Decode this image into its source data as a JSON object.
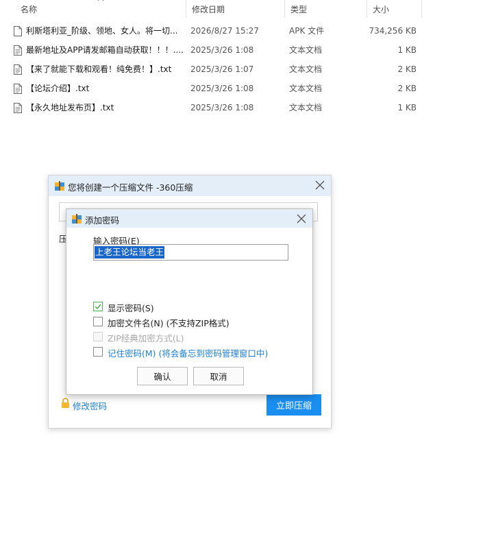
{
  "columns": {
    "name": "名称",
    "date": "修改日期",
    "type": "类型",
    "size": "大小"
  },
  "files": [
    {
      "name": "利斯塔利亚_阶级、领地、女人。将一切...",
      "date": "2026/8/27 15:27",
      "type": "APK 文件",
      "size": "734,256 KB",
      "icon": "file-icon"
    },
    {
      "name": "最新地址及APP请发邮箱自动获取！！！....",
      "date": "2025/3/26 1:08",
      "type": "文本文档",
      "size": "1 KB",
      "icon": "text-document-icon"
    },
    {
      "name": "【来了就能下载和观看！纯免费！】.txt",
      "date": "2025/3/26 1:07",
      "type": "文本文档",
      "size": "2 KB",
      "icon": "text-document-icon"
    },
    {
      "name": "【论坛介绍】.txt",
      "date": "2025/3/26 1:08",
      "type": "文本文档",
      "size": "2 KB",
      "icon": "text-document-icon"
    },
    {
      "name": "【永久地址发布页】.txt",
      "date": "2025/3/26 1:08",
      "type": "文本文档",
      "size": "1 KB",
      "icon": "text-document-icon"
    }
  ],
  "outer_dialog": {
    "title": "您将创建一个压缩文件 -360压缩",
    "label_fragment": "压",
    "edit_password": "修改密码",
    "compress_button": "立即压缩"
  },
  "inner_dialog": {
    "title": "添加密码",
    "password_label": "输入密码(E)",
    "password_value": "上老王论坛当老王",
    "options": [
      {
        "label": "显示密码(S)",
        "checked": true,
        "disabled": false
      },
      {
        "label": "加密文件名(N) (不支持ZIP格式)",
        "checked": false,
        "disabled": false
      },
      {
        "label": "ZIP经典加密方式(L)",
        "checked": false,
        "disabled": true
      },
      {
        "label": "记住密码(M) (将会备忘到密码管理窗口中)",
        "checked": false,
        "disabled": false
      }
    ],
    "ok_button": "确认",
    "cancel_button": "取消"
  },
  "colors": {
    "accent": "#1a8ff0",
    "link": "#1e7fd4",
    "title_bar": "#e4eef8",
    "selection": "#1a66c8",
    "check": "#4caf50"
  }
}
